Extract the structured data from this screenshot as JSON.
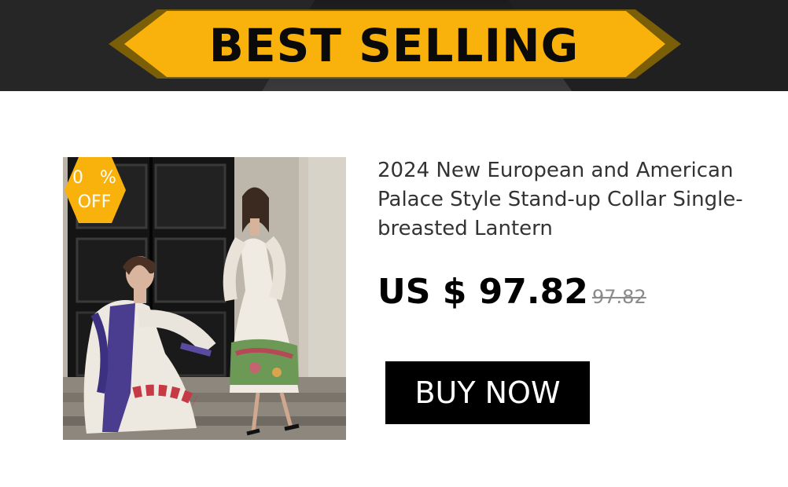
{
  "banner": {
    "title": "BEST SELLING",
    "colors": {
      "ribbon": "#f9b10c",
      "ribbon_shadow": "#8a6a00",
      "background": "#222222"
    }
  },
  "product": {
    "image_icon": "product-photo",
    "discount": {
      "value": "0",
      "percent_sign": "%",
      "off_label": "OFF",
      "color": "#f9b10c"
    },
    "title": "2024 New European and American Palace Style Stand-up Collar Single-breasted Lantern",
    "price_current": "US $ 97.82",
    "price_original": "97.82",
    "buy_label": "BUY NOW"
  }
}
